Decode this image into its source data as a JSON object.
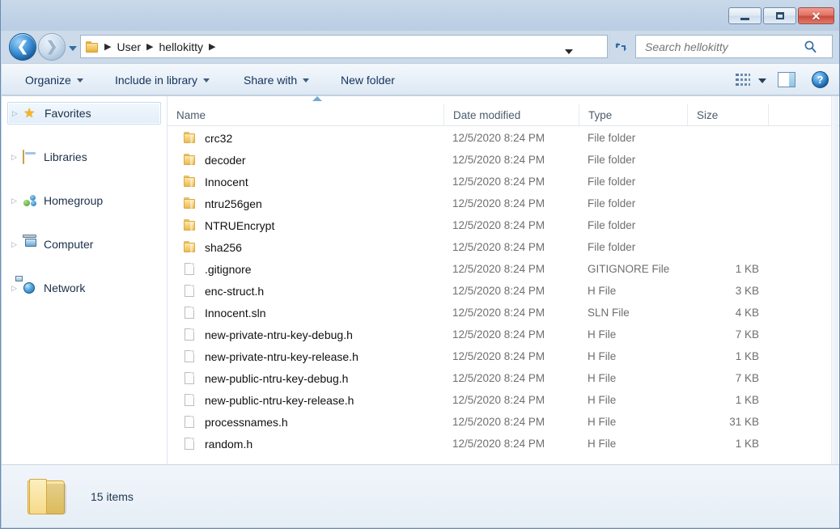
{
  "window": {
    "minimize_label": "Minimize",
    "maximize_label": "Maximize",
    "close_label": "✕"
  },
  "addressbar": {
    "back_glyph": "❮",
    "forward_glyph": "❯",
    "folder_icon": "folder-icon",
    "separator": "▶",
    "crumbs": [
      "User",
      "hellokitty"
    ],
    "refresh_icon": "refresh-icon"
  },
  "search": {
    "placeholder": "Search hellokitty",
    "value": "",
    "icon": "search-icon"
  },
  "toolbar": {
    "items": [
      {
        "label": "Organize",
        "has_caret": true
      },
      {
        "label": "Include in library",
        "has_caret": true
      },
      {
        "label": "Share with",
        "has_caret": true
      },
      {
        "label": "New folder",
        "has_caret": false
      }
    ],
    "view_icon": "view-options-icon",
    "preview_pane_icon": "preview-pane-icon",
    "help_label": "?"
  },
  "sidebar": {
    "items": [
      {
        "label": "Favorites",
        "icon": "star-icon",
        "selected": true
      },
      {
        "label": "Libraries",
        "icon": "libraries-icon",
        "selected": false
      },
      {
        "label": "Homegroup",
        "icon": "homegroup-icon",
        "selected": false
      },
      {
        "label": "Computer",
        "icon": "computer-icon",
        "selected": false
      },
      {
        "label": "Network",
        "icon": "network-icon",
        "selected": false
      }
    ],
    "chevron": "▷"
  },
  "filelist": {
    "columns": [
      "Name",
      "Date modified",
      "Type",
      "Size"
    ],
    "sort_column": "Name",
    "sort_direction": "ascending",
    "rows": [
      {
        "name": "crc32",
        "date": "12/5/2020 8:24 PM",
        "type": "File folder",
        "size": "",
        "kind": "folder"
      },
      {
        "name": "decoder",
        "date": "12/5/2020 8:24 PM",
        "type": "File folder",
        "size": "",
        "kind": "folder"
      },
      {
        "name": "Innocent",
        "date": "12/5/2020 8:24 PM",
        "type": "File folder",
        "size": "",
        "kind": "folder"
      },
      {
        "name": "ntru256gen",
        "date": "12/5/2020 8:24 PM",
        "type": "File folder",
        "size": "",
        "kind": "folder"
      },
      {
        "name": "NTRUEncrypt",
        "date": "12/5/2020 8:24 PM",
        "type": "File folder",
        "size": "",
        "kind": "folder"
      },
      {
        "name": "sha256",
        "date": "12/5/2020 8:24 PM",
        "type": "File folder",
        "size": "",
        "kind": "folder"
      },
      {
        "name": ".gitignore",
        "date": "12/5/2020 8:24 PM",
        "type": "GITIGNORE File",
        "size": "1 KB",
        "kind": "file"
      },
      {
        "name": "enc-struct.h",
        "date": "12/5/2020 8:24 PM",
        "type": "H File",
        "size": "3 KB",
        "kind": "file"
      },
      {
        "name": "Innocent.sln",
        "date": "12/5/2020 8:24 PM",
        "type": "SLN File",
        "size": "4 KB",
        "kind": "file"
      },
      {
        "name": "new-private-ntru-key-debug.h",
        "date": "12/5/2020 8:24 PM",
        "type": "H File",
        "size": "7 KB",
        "kind": "file"
      },
      {
        "name": "new-private-ntru-key-release.h",
        "date": "12/5/2020 8:24 PM",
        "type": "H File",
        "size": "1 KB",
        "kind": "file"
      },
      {
        "name": "new-public-ntru-key-debug.h",
        "date": "12/5/2020 8:24 PM",
        "type": "H File",
        "size": "7 KB",
        "kind": "file"
      },
      {
        "name": "new-public-ntru-key-release.h",
        "date": "12/5/2020 8:24 PM",
        "type": "H File",
        "size": "1 KB",
        "kind": "file"
      },
      {
        "name": "processnames.h",
        "date": "12/5/2020 8:24 PM",
        "type": "H File",
        "size": "31 KB",
        "kind": "file"
      },
      {
        "name": "random.h",
        "date": "12/5/2020 8:24 PM",
        "type": "H File",
        "size": "1 KB",
        "kind": "file"
      }
    ]
  },
  "statusbar": {
    "item_count_label": "15 items",
    "folder_icon": "large-folder-icon"
  },
  "colors": {
    "chrome": "#c0d2e6",
    "toolbar": "#e8f0f8",
    "accent_blue": "#2f6ca6",
    "folder_yellow": "#f3d069",
    "close_red": "#c9483a",
    "selected_row": "#e2eefa"
  }
}
